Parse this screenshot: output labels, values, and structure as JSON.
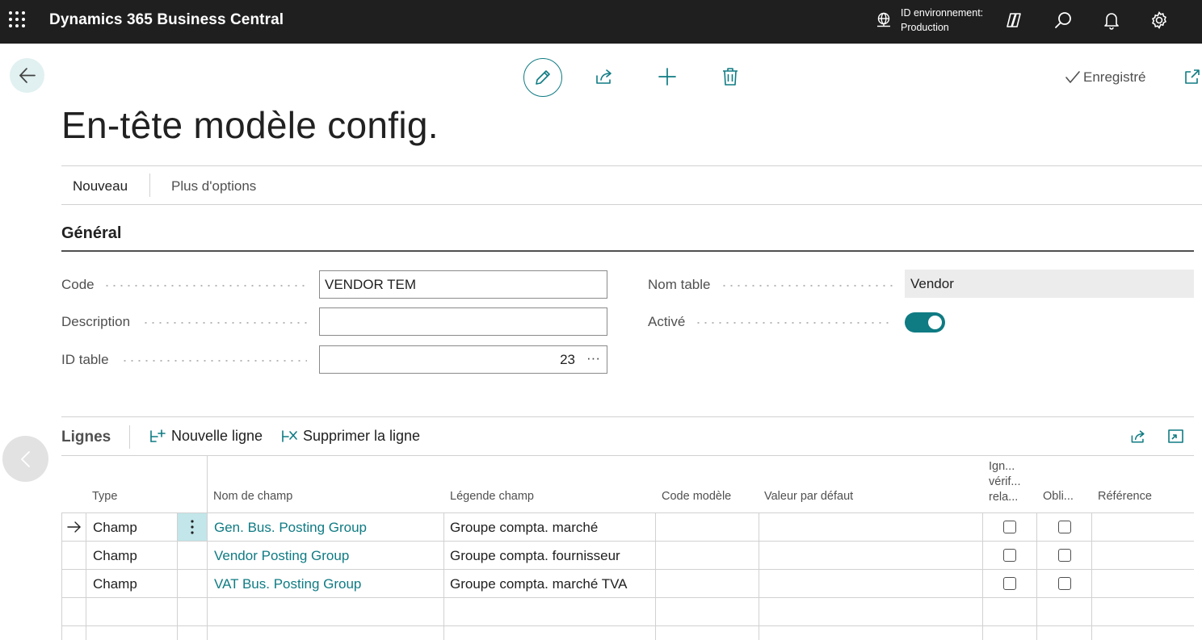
{
  "app": {
    "title": "Dynamics 365 Business Central",
    "environment_label": "ID environnement:",
    "environment_value": "Production",
    "accent_color": "#0f7b83"
  },
  "page": {
    "title": "En-tête modèle config.",
    "status": "Enregistré"
  },
  "actionbar": {
    "new_label": "Nouveau",
    "more_label": "Plus d'options"
  },
  "general": {
    "title": "Général",
    "code_label": "Code",
    "code_value": "VENDOR TEM",
    "description_label": "Description",
    "description_value": "",
    "table_id_label": "ID table",
    "table_id_value": "23",
    "table_id_lookup": "···",
    "table_name_label": "Nom table",
    "table_name_value": "Vendor",
    "enabled_label": "Activé",
    "enabled_value": true
  },
  "lines": {
    "title": "Lignes",
    "new_line_label": "Nouvelle ligne",
    "delete_line_label": "Supprimer la ligne",
    "columns": {
      "type": "Type",
      "field_name": "Nom de champ",
      "field_caption": "Légende champ",
      "template_code": "Code modèle",
      "default_value": "Valeur par défaut",
      "skip_relation_check_1": "Ign...",
      "skip_relation_check_2": "vérif...",
      "skip_relation_check_3": "rela...",
      "mandatory": "Obli...",
      "reference": "Référence"
    },
    "rows": [
      {
        "type": "Champ",
        "field_name": "Gen. Bus. Posting Group",
        "field_caption": "Groupe compta. marché",
        "template_code": "",
        "default_value": "",
        "skip_relation_check": false,
        "mandatory": false,
        "reference": ""
      },
      {
        "type": "Champ",
        "field_name": "Vendor Posting Group",
        "field_caption": "Groupe compta. fournisseur",
        "template_code": "",
        "default_value": "",
        "skip_relation_check": false,
        "mandatory": false,
        "reference": ""
      },
      {
        "type": "Champ",
        "field_name": "VAT Bus. Posting Group",
        "field_caption": "Groupe compta. marché TVA",
        "template_code": "",
        "default_value": "",
        "skip_relation_check": false,
        "mandatory": false,
        "reference": ""
      }
    ]
  },
  "icons": [
    "waffle-icon",
    "globe-icon",
    "copilot-icon",
    "search-icon",
    "bell-icon",
    "gear-icon",
    "back-arrow-icon",
    "edit-icon",
    "share-icon",
    "add-icon",
    "delete-icon",
    "checkmark-icon",
    "popout-icon",
    "new-line-icon",
    "delete-line-icon",
    "expand-icon",
    "chevron-left-icon",
    "current-row-arrow-icon",
    "row-menu-icon"
  ]
}
